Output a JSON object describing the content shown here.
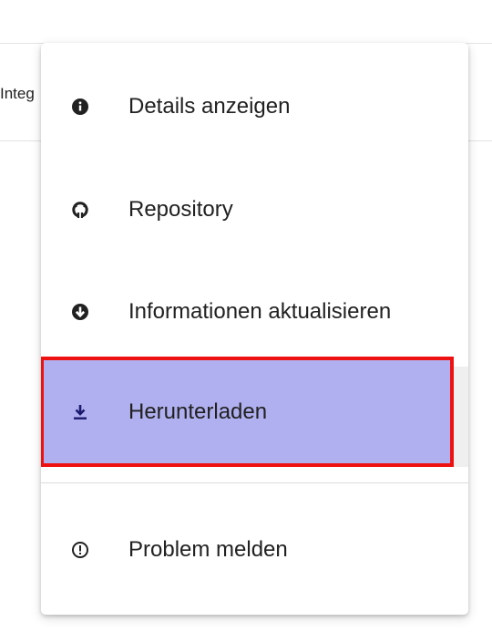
{
  "background": {
    "partial_text": "Integ"
  },
  "menu": {
    "items": [
      {
        "label": "Details anzeigen",
        "icon": "info-icon"
      },
      {
        "label": "Repository",
        "icon": "github-icon"
      },
      {
        "label": "Informationen aktualisieren",
        "icon": "arrow-down-circle-icon"
      },
      {
        "label": "Herunterladen",
        "icon": "download-icon",
        "highlighted": true
      },
      {
        "label": "Problem melden",
        "icon": "alert-circle-icon"
      }
    ]
  },
  "colors": {
    "highlight_bg": "#b0b0f0",
    "highlight_border": "#ee1111",
    "icon_dark": "#212121",
    "download_icon": "#1a1a6e"
  }
}
